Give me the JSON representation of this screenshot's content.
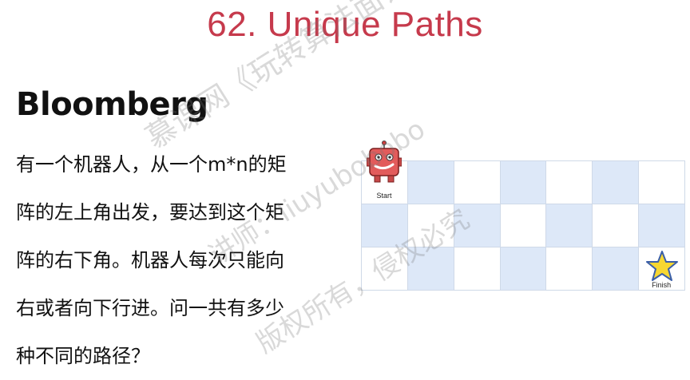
{
  "title": "62. Unique Paths",
  "company": "Bloomberg",
  "problem_lines": [
    "有一个机器人，从一个m*n的矩",
    "阵的左上角出发，要达到这个矩",
    "阵的右下角。机器人每次只能向",
    "右或者向下行进。问一共有多少",
    "种不同的路径？"
  ],
  "grid": {
    "rows": 3,
    "cols": 7,
    "start_label": "Start",
    "finish_label": "Finish",
    "shade_color": "#dde8f8",
    "robot_icon": "robot-icon",
    "finish_icon": "star-icon"
  },
  "watermark": {
    "line1": "慕课网《玩转算法面试",
    "line2": "讲师：liuyubobobo",
    "line3": "版权所有，侵权必究"
  },
  "colors": {
    "title": "#c63a4c",
    "text": "#111111"
  }
}
